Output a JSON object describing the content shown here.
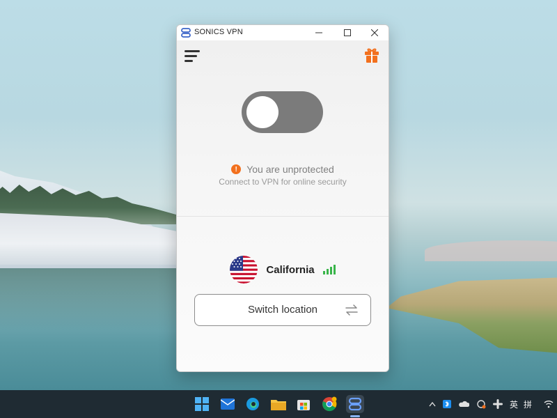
{
  "window": {
    "title": "SONICS VPN",
    "controls": [
      "minimize-icon",
      "maximize-icon",
      "close-icon"
    ]
  },
  "header": {
    "menu_icon": "hamburger-menu-icon",
    "gift_icon": "gift-icon",
    "accent_color": "#f2701e"
  },
  "connection": {
    "toggle_state": "off",
    "status_title": "You are unprotected",
    "status_subtitle": "Connect to VPN for online security",
    "status_icon": "warning-icon",
    "status_color": "#f2701e"
  },
  "location": {
    "name": "California",
    "flag": "us-flag",
    "signal_icon": "signal-strength-icon",
    "signal_color": "#39b54a",
    "switch_label": "Switch location",
    "switch_icon": "swap-arrows-icon"
  },
  "taskbar": {
    "apps": [
      "windows-start-icon",
      "mail-icon",
      "edge-icon",
      "file-explorer-icon",
      "microsoft-store-icon",
      "chrome-icon",
      "sonics-vpn-icon"
    ],
    "active_app": "sonics-vpn-icon",
    "tray": {
      "ime_lang": "英",
      "ime_mode": "拼"
    }
  }
}
